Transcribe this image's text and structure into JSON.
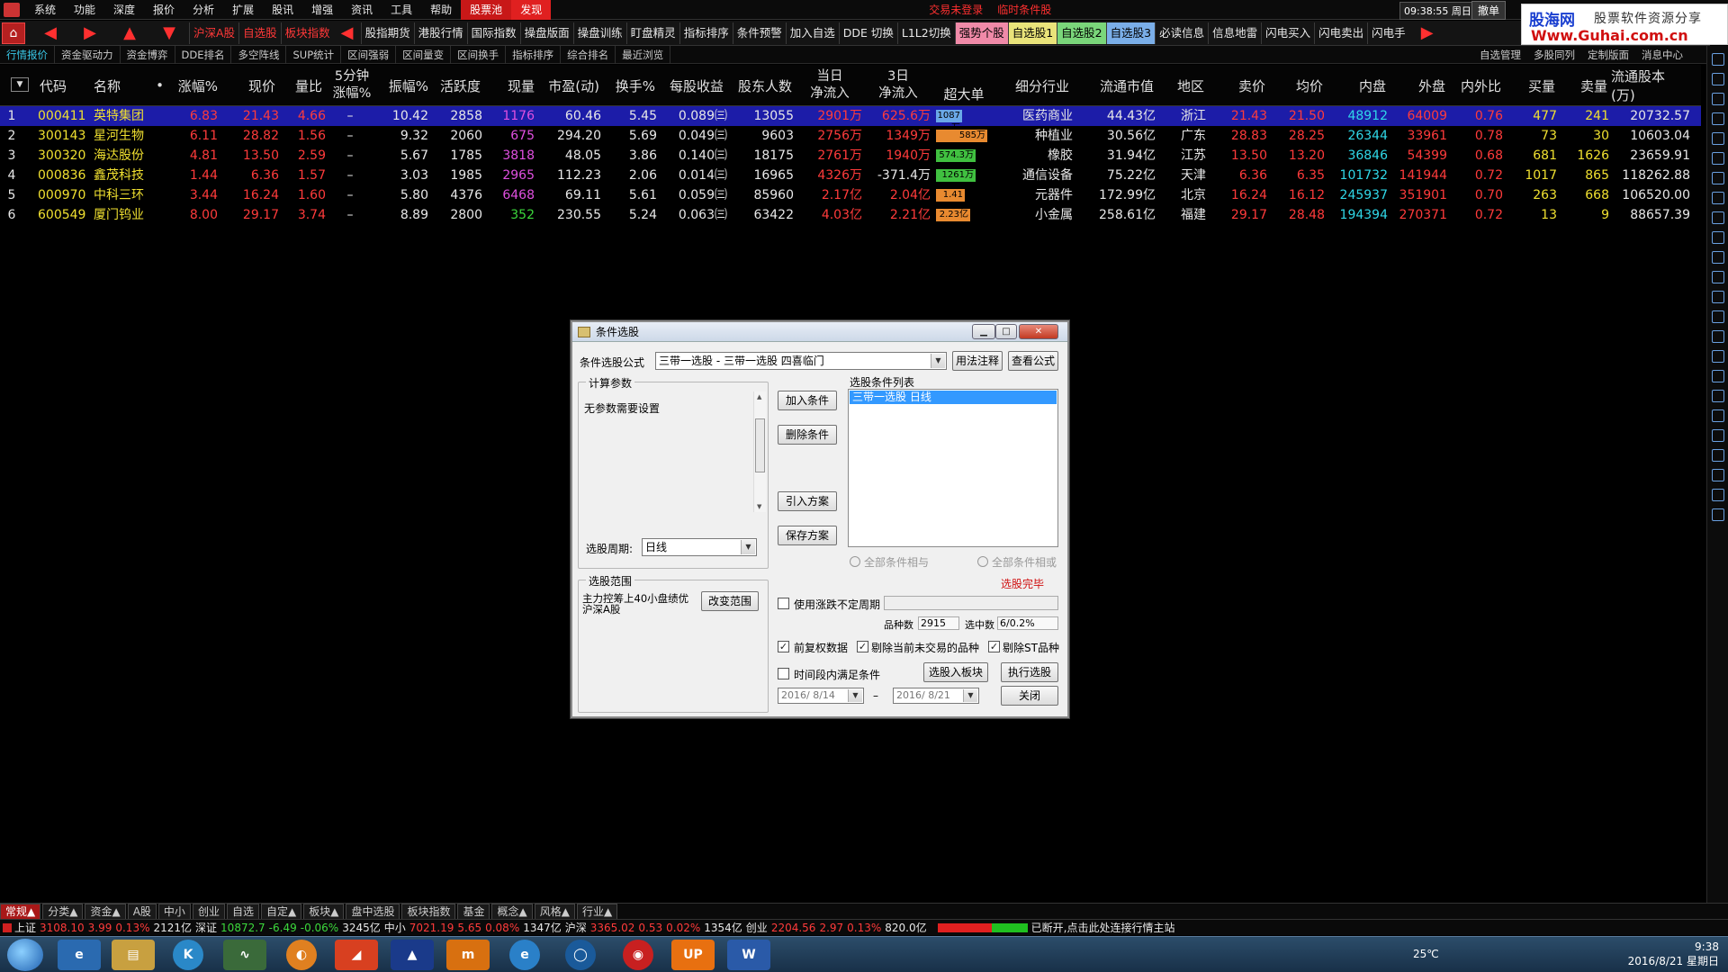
{
  "menubar": {
    "items": [
      "系统",
      "功能",
      "深度",
      "报价",
      "分析",
      "扩展",
      "股讯",
      "增强",
      "资讯",
      "工具",
      "帮助"
    ],
    "highlight1": "股票池",
    "highlight2": "发现",
    "center_notice1": "交易未登录",
    "center_notice2": "临时条件股",
    "clock": "09:38:55 周日",
    "cancel": "撤单"
  },
  "watermark": {
    "brand": "股海网",
    "slogan": "股票软件资源分享",
    "url": "Www.Guhai.com.cn"
  },
  "toolbar": {
    "buttons": [
      {
        "label": "沪深A股",
        "style": "red"
      },
      {
        "label": "自选股",
        "style": "red"
      },
      {
        "label": "板块指数",
        "style": "red"
      },
      {
        "label": "股指期货",
        "style": ""
      },
      {
        "label": "港股行情",
        "style": ""
      },
      {
        "label": "国际指数",
        "style": ""
      },
      {
        "label": "操盘版面",
        "style": ""
      },
      {
        "label": "操盘训练",
        "style": ""
      },
      {
        "label": "盯盘精灵",
        "style": ""
      },
      {
        "label": "指标排序",
        "style": ""
      },
      {
        "label": "条件预警",
        "style": ""
      },
      {
        "label": "加入自选",
        "style": ""
      },
      {
        "label": "DDE 切换",
        "style": ""
      },
      {
        "label": "L1L2切换",
        "style": ""
      },
      {
        "label": "强势个股",
        "style": "pink"
      },
      {
        "label": "自选股1",
        "style": "yellow"
      },
      {
        "label": "自选股2",
        "style": "green"
      },
      {
        "label": "自选股3",
        "style": "blue"
      },
      {
        "label": "必读信息",
        "style": ""
      },
      {
        "label": "信息地雷",
        "style": ""
      },
      {
        "label": "闪电买入",
        "style": ""
      },
      {
        "label": "闪电卖出",
        "style": ""
      },
      {
        "label": "闪电手",
        "style": ""
      }
    ]
  },
  "subbar": {
    "items": [
      "行情报价",
      "资金驱动力",
      "资金博弈",
      "DDE排名",
      "多空阵线",
      "SUP统计",
      "区间强弱",
      "区间量变",
      "区间换手",
      "指标排序",
      "综合排名",
      "最近浏览"
    ],
    "right": [
      "自选管理",
      "多股同列",
      "定制版面",
      "消息中心"
    ]
  },
  "table": {
    "headers": {
      "code": "代码",
      "name": "名称",
      "dot": "•",
      "chg": "涨幅%",
      "price": "现价",
      "vr": "量比",
      "min5_top": "5分钟",
      "min5_bot": "涨幅%",
      "amp": "振幅%",
      "act": "活跃度",
      "vol": "现量",
      "pe": "市盈(动)",
      "turn": "换手%",
      "eps": "每股收益",
      "holders": "股东人数",
      "today_top": "当日",
      "today_bot": "净流入",
      "d3_top": "3日",
      "d3_bot": "净流入",
      "big": "超大单",
      "industry": "细分行业",
      "mcap": "流通市值",
      "region": "地区",
      "ask": "卖价",
      "avg": "均价",
      "inner": "内盘",
      "outer": "外盘",
      "io": "内外比",
      "bidv": "买量",
      "askv": "卖量",
      "float": "流通股本(万)"
    },
    "rows": [
      {
        "idx": "1",
        "code": "000411",
        "name": "英特集团",
        "chg": "6.83",
        "price": "21.43",
        "vr": "4.66",
        "min5": "–",
        "amp": "10.42",
        "act": "2858",
        "vol": "1176",
        "pe": "60.46",
        "turn": "5.45",
        "eps": "0.089㈢",
        "holders": "13055",
        "today": "2901万",
        "d3": "625.6万",
        "big": "1087万",
        "big_ratio": 0.3,
        "big_color": "#6aa8e8",
        "industry": "医药商业",
        "mcap": "44.43亿",
        "region": "浙江",
        "ask": "21.43",
        "avg": "21.50",
        "inner": "48912",
        "outer": "64009",
        "io": "0.76",
        "bidv": "477",
        "askv": "241",
        "float": "20732.57"
      },
      {
        "idx": "2",
        "code": "300143",
        "name": "星河生物",
        "chg": "6.11",
        "price": "28.82",
        "vr": "1.56",
        "min5": "–",
        "amp": "9.32",
        "act": "2060",
        "vol": "675",
        "pe": "294.20",
        "turn": "5.69",
        "eps": "0.049㈢",
        "holders": "9603",
        "today": "2756万",
        "d3": "1349万",
        "big": "585万",
        "big_ratio": 0.75,
        "big_color": "#e88a30",
        "industry": "种植业",
        "mcap": "30.56亿",
        "region": "广东",
        "ask": "28.83",
        "avg": "28.25",
        "inner": "26344",
        "outer": "33961",
        "io": "0.78",
        "bidv": "73",
        "askv": "30",
        "float": "10603.04"
      },
      {
        "idx": "3",
        "code": "300320",
        "name": "海达股份",
        "chg": "4.81",
        "price": "13.50",
        "vr": "2.59",
        "min5": "–",
        "amp": "5.67",
        "act": "1785",
        "vol": "3818",
        "pe": "48.05",
        "turn": "3.86",
        "eps": "0.140㈢",
        "holders": "18175",
        "today": "2761万",
        "d3": "1940万",
        "big": "574.3万",
        "big_ratio": 0.55,
        "big_color": "#40c040",
        "industry": "橡胶",
        "mcap": "31.94亿",
        "region": "江苏",
        "ask": "13.50",
        "avg": "13.20",
        "inner": "36846",
        "outer": "54399",
        "io": "0.68",
        "bidv": "681",
        "askv": "1626",
        "float": "23659.91"
      },
      {
        "idx": "4",
        "code": "000836",
        "name": "鑫茂科技",
        "chg": "1.44",
        "price": "6.36",
        "vr": "1.57",
        "min5": "–",
        "amp": "3.03",
        "act": "1985",
        "vol": "2965",
        "pe": "112.23",
        "turn": "2.06",
        "eps": "0.014㈢",
        "holders": "16965",
        "today": "4326万",
        "d3": "-371.4万",
        "big": "1261万",
        "big_ratio": 0.55,
        "big_color": "#40c040",
        "industry": "通信设备",
        "mcap": "75.22亿",
        "region": "天津",
        "ask": "6.36",
        "avg": "6.35",
        "inner": "101732",
        "outer": "141944",
        "io": "0.72",
        "bidv": "1017",
        "askv": "865",
        "float": "118262.88"
      },
      {
        "idx": "5",
        "code": "000970",
        "name": "中科三环",
        "chg": "3.44",
        "price": "16.24",
        "vr": "1.60",
        "min5": "–",
        "amp": "5.80",
        "act": "4376",
        "vol": "6468",
        "pe": "69.11",
        "turn": "5.61",
        "eps": "0.059㈢",
        "holders": "85960",
        "today": "2.17亿",
        "d3": "2.04亿",
        "big": "1.41亿",
        "big_ratio": 0.35,
        "big_color": "#e88a30",
        "industry": "元器件",
        "mcap": "172.99亿",
        "region": "北京",
        "ask": "16.24",
        "avg": "16.12",
        "inner": "245937",
        "outer": "351901",
        "io": "0.70",
        "bidv": "263",
        "askv": "668",
        "float": "106520.00"
      },
      {
        "idx": "6",
        "code": "600549",
        "name": "厦门钨业",
        "chg": "8.00",
        "price": "29.17",
        "vr": "3.74",
        "min5": "–",
        "amp": "8.89",
        "act": "2800",
        "vol": "352",
        "pe": "230.55",
        "turn": "5.24",
        "eps": "0.063㈢",
        "holders": "63422",
        "today": "4.03亿",
        "d3": "2.21亿",
        "big": "2.23亿",
        "big_ratio": 0.45,
        "big_color": "#e88a30",
        "industry": "小金属",
        "mcap": "258.61亿",
        "region": "福建",
        "ask": "29.17",
        "avg": "28.48",
        "inner": "194394",
        "outer": "270371",
        "io": "0.72",
        "bidv": "13",
        "askv": "9",
        "float": "88657.39"
      }
    ]
  },
  "dialog": {
    "title": "条件选股",
    "formula_label": "条件选股公式",
    "formula_value": "三带一选股  - 三带一选股 四喜临门",
    "usage_btn": "用法注释",
    "view_btn": "查看公式",
    "params_group": "计算参数",
    "params_text": "无参数需要设置",
    "period_label": "选股周期:",
    "period_value": "日线",
    "add_btn": "加入条件",
    "delete_btn": "删除条件",
    "import_btn": "引入方案",
    "save_btn": "保存方案",
    "list_label": "选股条件列表",
    "list_item": "三带一选股  日线",
    "radio_and": "全部条件相与",
    "radio_or": "全部条件相或",
    "done_text": "选股完毕",
    "range_group": "选股范围",
    "range_text": "主力控筹上40小盘绩优 沪深A股",
    "change_range_btn": "改变范围",
    "use_period_label": "使用涨跌不定周期",
    "count_label": "品种数",
    "count_value": "2915",
    "selected_label": "选中数",
    "selected_value": "6/0.2%",
    "chk_adjust": "前复权数据",
    "chk_exclude_notrade": "剔除当前未交易的品种",
    "chk_exclude_st": "剔除ST品种",
    "chk_time": "时间段内满足条件",
    "to_block_btn": "选股入板块",
    "exec_btn": "执行选股",
    "date_from": "2016/ 8/14",
    "date_sep": "–",
    "date_to": "2016/ 8/21",
    "close_btn": "关闭"
  },
  "bottomtabs": [
    "常规▲",
    "分类▲",
    "资金▲",
    "A股",
    "中小",
    "创业",
    "自选",
    "自定▲",
    "板块▲",
    "盘中选股",
    "板块指数",
    "基金",
    "概念▲",
    "风格▲",
    "行业▲"
  ],
  "statusbar": {
    "sh_label": "上证",
    "sh_val": "3108.10",
    "sh_chg": "3.99",
    "sh_pct": "0.13%",
    "sh_amt": "2121亿",
    "sz_label": "深证",
    "sz_val": "10872.7",
    "sz_chg": "-6.49",
    "sz_pct": "-0.06%",
    "sz_amt": "3245亿",
    "zx_label": "中小",
    "zx_val": "7021.19",
    "zx_chg": "5.65",
    "zx_pct": "0.08%",
    "zx_amt": "1347亿",
    "hs_label": "沪深",
    "hs_val": "3365.02",
    "hs_chg": "0.53",
    "hs_pct": "0.02%",
    "hs_amt": "1354亿",
    "cy_label": "创业",
    "cy_val": "2204.56",
    "cy_chg": "2.97",
    "cy_pct": "0.13%",
    "cy_amt": "820.0亿",
    "msg": "已断开,点击此处连接行情主站"
  },
  "taskbar": {
    "temp": "25℃",
    "time": "9:38",
    "date": "2016/8/21 星期日"
  }
}
